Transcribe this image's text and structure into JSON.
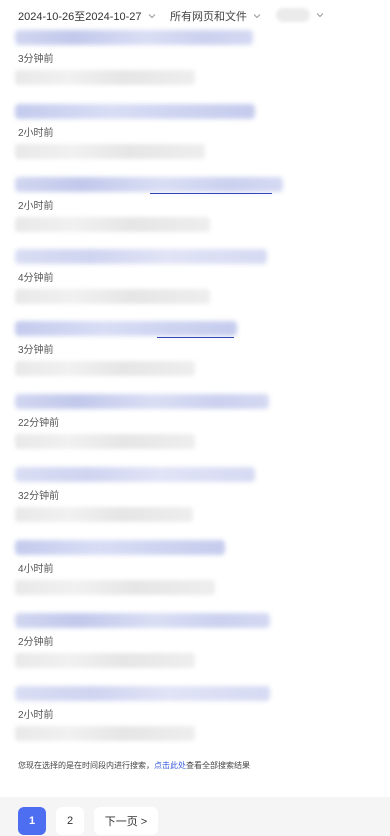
{
  "filters": {
    "date_range": "2024-10-26至2024-10-27",
    "file_type": "所有网页和文件"
  },
  "results": [
    {
      "time": "3分钟前"
    },
    {
      "time": "2小时前"
    },
    {
      "time": "2小时前"
    },
    {
      "time": "4分钟前"
    },
    {
      "time": "3分钟前"
    },
    {
      "time": "22分钟前"
    },
    {
      "time": "32分钟前"
    },
    {
      "time": "4小时前"
    },
    {
      "time": "2分钟前"
    },
    {
      "time": "2小时前"
    }
  ],
  "notice": {
    "prefix": "您现在选择的是在时间段内进行搜索，",
    "link": "点击此处",
    "suffix": "查看全部搜索结果"
  },
  "pagination": {
    "current": "1",
    "next_page_number": "2",
    "next_label": "下一页 >"
  },
  "colors": {
    "accent": "#4e6ef2",
    "link": "#3b5bdb"
  }
}
